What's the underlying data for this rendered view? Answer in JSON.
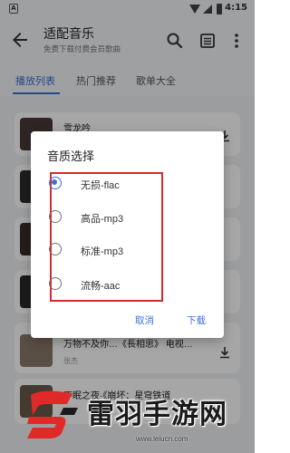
{
  "status_bar": {
    "time": "4:15",
    "notification": "A"
  },
  "app_bar": {
    "title": "适配音乐",
    "subtitle": "免费下载付费会员歌曲"
  },
  "tabs": [
    {
      "label": "播放列表",
      "active": true
    },
    {
      "label": "热门推荐",
      "active": false
    },
    {
      "label": "歌单大全",
      "active": false
    }
  ],
  "songs": [
    {
      "title": "雪龙吟",
      "artist": ""
    },
    {
      "title": "万物不及你…《長相思》 电视…",
      "artist": "张杰"
    },
    {
      "title": "不眠之夜·《崩坏：星穹铁道",
      "artist": ""
    }
  ],
  "dialog": {
    "title": "音质选择",
    "options": [
      {
        "label": "无损-flac",
        "selected": true
      },
      {
        "label": "高品-mp3",
        "selected": false
      },
      {
        "label": "标准-mp3",
        "selected": false
      },
      {
        "label": "流畅-aac",
        "selected": false
      }
    ],
    "cancel": "取消",
    "confirm": "下载"
  },
  "watermark": {
    "text": "雷羽手游网",
    "url": "www.leiucn.com"
  },
  "colors": {
    "accent": "#3b6fd8",
    "highlight_box": "#d42b2b",
    "scrim": "rgba(0,0,0,0.35)"
  }
}
